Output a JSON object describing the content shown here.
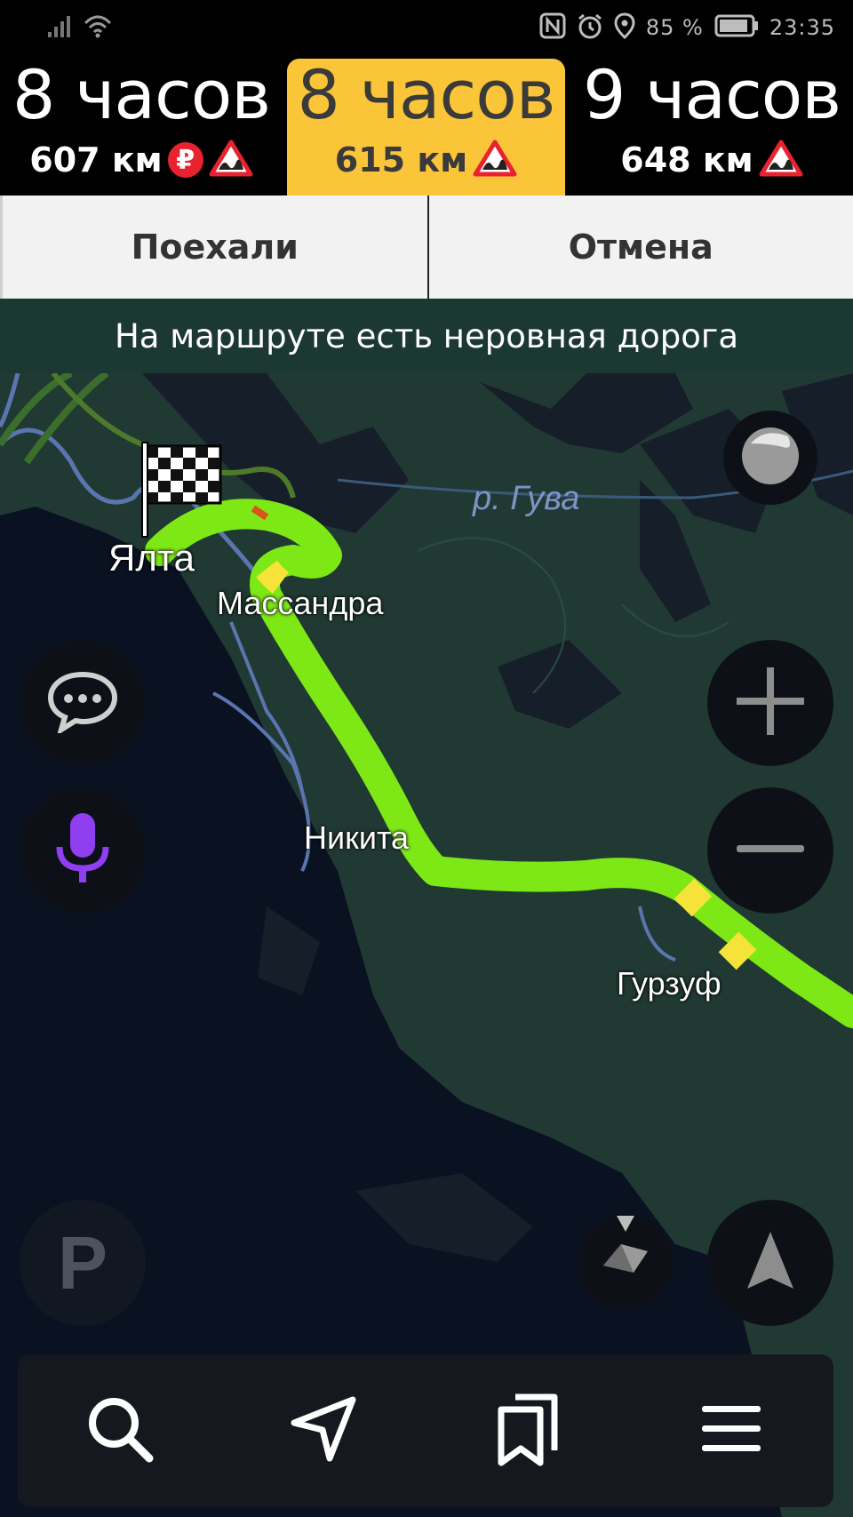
{
  "status_bar": {
    "battery_percent": "85 %",
    "time": "23:35"
  },
  "routes": [
    {
      "time": "8 часов",
      "distance": "607 км",
      "selected": false,
      "toll": true,
      "rough_road": true
    },
    {
      "time": "8 часов",
      "distance": "615 км",
      "selected": true,
      "toll": false,
      "rough_road": true
    },
    {
      "time": "9 часов",
      "distance": "648 км",
      "selected": false,
      "toll": false,
      "rough_road": true
    }
  ],
  "actions": {
    "go_label": "Поехали",
    "cancel_label": "Отмена"
  },
  "warning": {
    "text": "На маршруте есть неровная дорога"
  },
  "map": {
    "labels": {
      "river": "р. Гува",
      "yalta": "Ялта",
      "massandra": "Массандра",
      "nikita": "Никита",
      "gurzuf": "Гурзуф"
    },
    "colors": {
      "route": "#7ee817",
      "land": "#203a33",
      "sea": "#0a1222",
      "water": "#5a75b0"
    }
  },
  "controls": {
    "parking_label": "P"
  },
  "icons": {
    "status": [
      "signal-icon",
      "wifi-icon",
      "nfc-icon",
      "alarm-icon",
      "location-icon",
      "battery-icon"
    ],
    "map": [
      "finish-flag-icon",
      "layers-icon",
      "chat-icon",
      "microphone-icon",
      "zoom-in-icon",
      "zoom-out-icon",
      "compass-icon",
      "navigation-arrow-icon",
      "parking-icon"
    ],
    "bottom_nav": [
      "search-icon",
      "route-icon",
      "bookmarks-icon",
      "menu-icon"
    ]
  }
}
